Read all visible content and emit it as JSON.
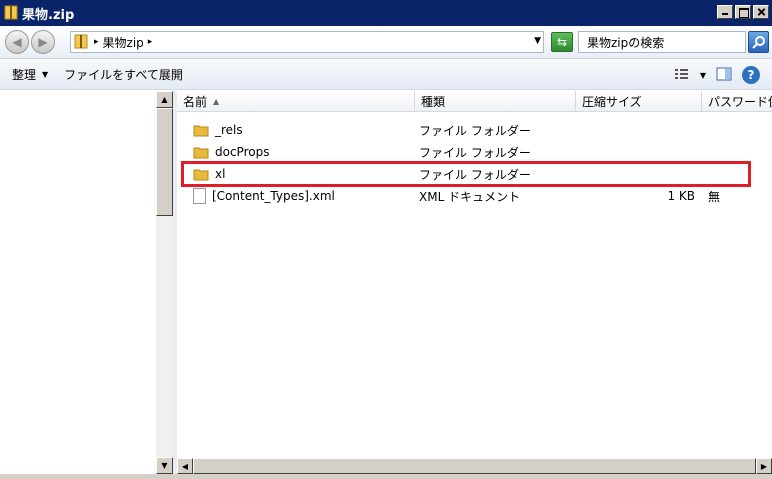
{
  "window": {
    "title": "果物.zip"
  },
  "address": {
    "crumb": "果物zip",
    "search_placeholder": "果物zipの検索"
  },
  "toolbar": {
    "organize": "整理",
    "extract_all": "ファイルをすべて展開"
  },
  "columns": {
    "name": "名前",
    "type": "種類",
    "compressed_size": "圧縮サイズ",
    "password": "パスワード保..."
  },
  "files": [
    {
      "name": "_rels",
      "type": "ファイル フォルダー",
      "size": "",
      "password": "",
      "icon": "folder-icon"
    },
    {
      "name": "docProps",
      "type": "ファイル フォルダー",
      "size": "",
      "password": "",
      "icon": "folder-icon"
    },
    {
      "name": "xl",
      "type": "ファイル フォルダー",
      "size": "",
      "password": "",
      "icon": "folder-icon",
      "highlighted": true
    },
    {
      "name": "[Content_Types].xml",
      "type": "XML ドキュメント",
      "size": "1 KB",
      "password": "無",
      "icon": "xml-file-icon"
    }
  ],
  "colors": {
    "titlebar": "#0a246a",
    "highlight": "#e21d2a",
    "folder": "#e8b93a"
  }
}
